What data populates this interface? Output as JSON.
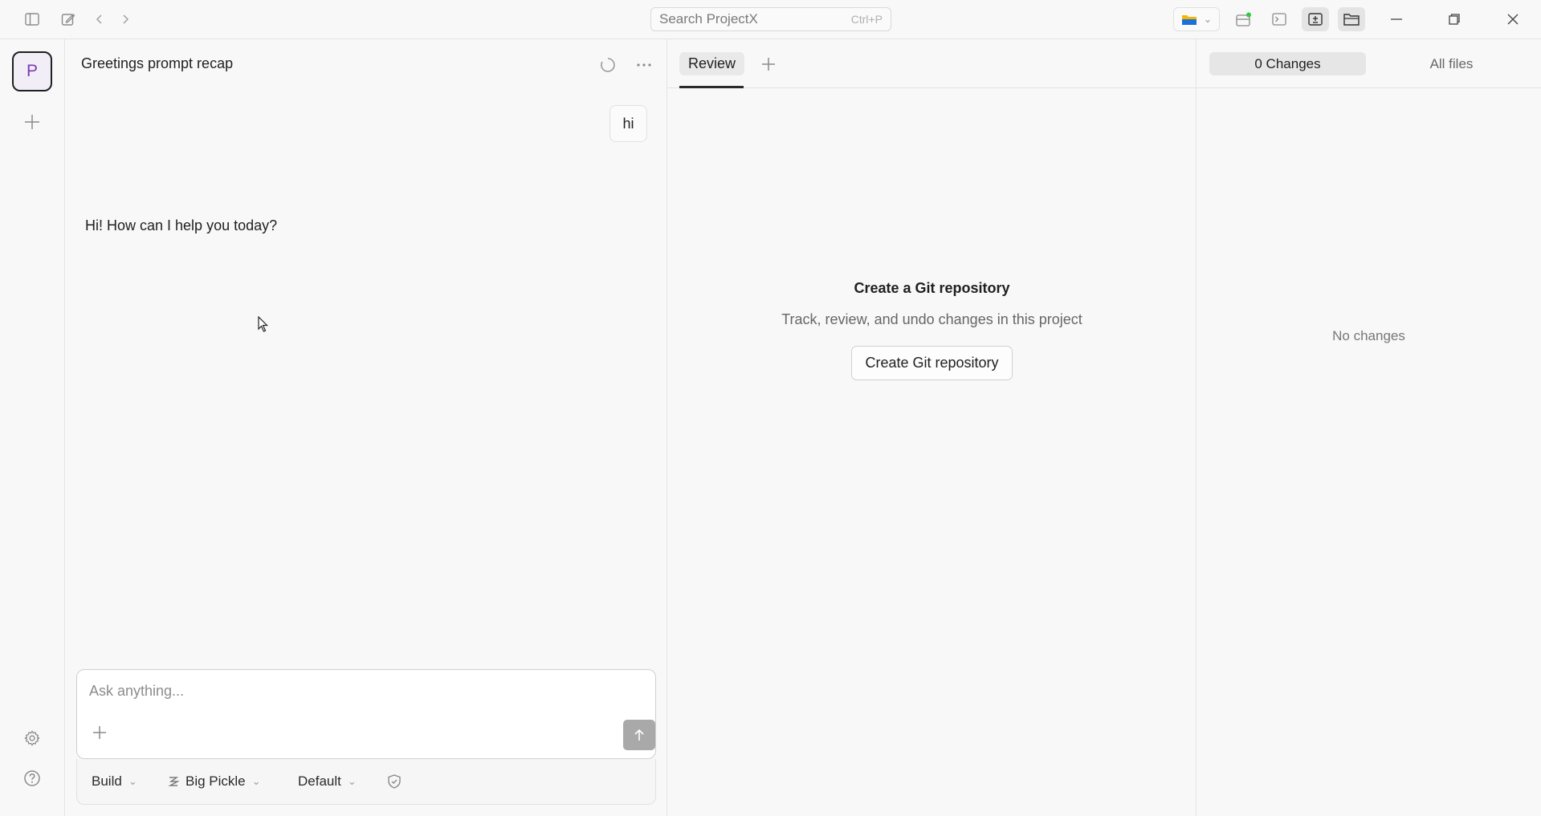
{
  "titlebar": {
    "search_placeholder": "Search ProjectX",
    "search_shortcut": "Ctrl+P"
  },
  "rail": {
    "project_initial": "P"
  },
  "chat": {
    "title": "Greetings prompt recap",
    "messages": [
      {
        "role": "user",
        "text": "hi"
      },
      {
        "role": "assistant",
        "text": "Hi! How can I help you today?"
      }
    ],
    "composer": {
      "placeholder": "Ask anything...",
      "agent_label": "Build",
      "model_label": "Big Pickle",
      "variant_label": "Default"
    }
  },
  "review": {
    "tab_label": "Review",
    "empty_title": "Create a Git repository",
    "empty_subtitle": "Track, review, and undo changes in this project",
    "create_button": "Create Git repository"
  },
  "changes": {
    "changes_tab": "0 Changes",
    "all_files_tab": "All files",
    "empty_text": "No changes"
  },
  "colors": {
    "accent_purple": "#7c3bb0",
    "send_button": "#a9a9a9"
  }
}
